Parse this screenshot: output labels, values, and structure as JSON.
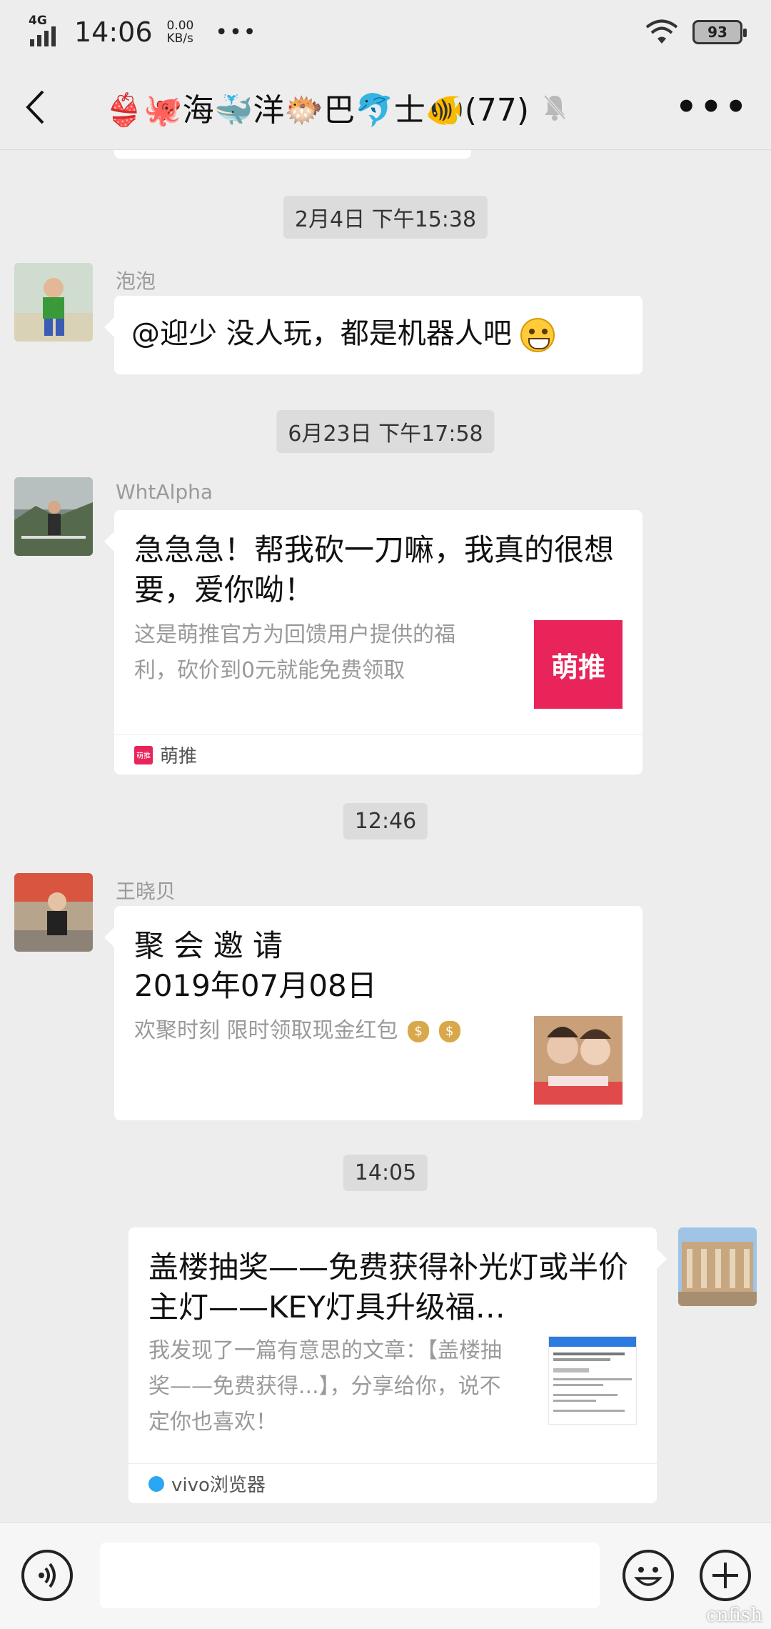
{
  "status": {
    "network": "4G",
    "time": "14:06",
    "speed": "0.00\nKB/s",
    "dots": "•••",
    "battery": "93"
  },
  "header": {
    "title": "👙🐙海🐳洋🐡巴🐬士🐠(77)",
    "more": "•••"
  },
  "messages": {
    "t1": "2月4日 下午15:38",
    "m1": {
      "sender": "泡泡",
      "text": "@迎少  没人玩，都是机器人吧"
    },
    "t2": "6月23日 下午17:58",
    "m2": {
      "sender": "WhtAlpha",
      "title": "急急急！帮我砍一刀嘛，我真的很想要，爱你呦！",
      "desc": "这是萌推官方为回馈用户提供的福利，砍价到0元就能免费领取",
      "thumb": "萌推",
      "source_icon": "萌推",
      "source": "萌推"
    },
    "t3": "12:46",
    "m3": {
      "sender": "王晓贝",
      "title_line1": "聚 会 邀 请",
      "title_line2": "2019年07月08日",
      "desc": "欢聚时刻  限时领取现金红包",
      "money_icon": "$"
    },
    "t4": "14:05",
    "m4": {
      "title": "盖楼抽奖——免费获得补光灯或半价主灯——KEY灯具升级福…",
      "desc": "我发现了一篇有意思的文章：【盖楼抽奖——免费获得...】，分享给你，说不定你也喜欢！",
      "source": "vivo浏览器"
    }
  },
  "watermark": "cnfish"
}
